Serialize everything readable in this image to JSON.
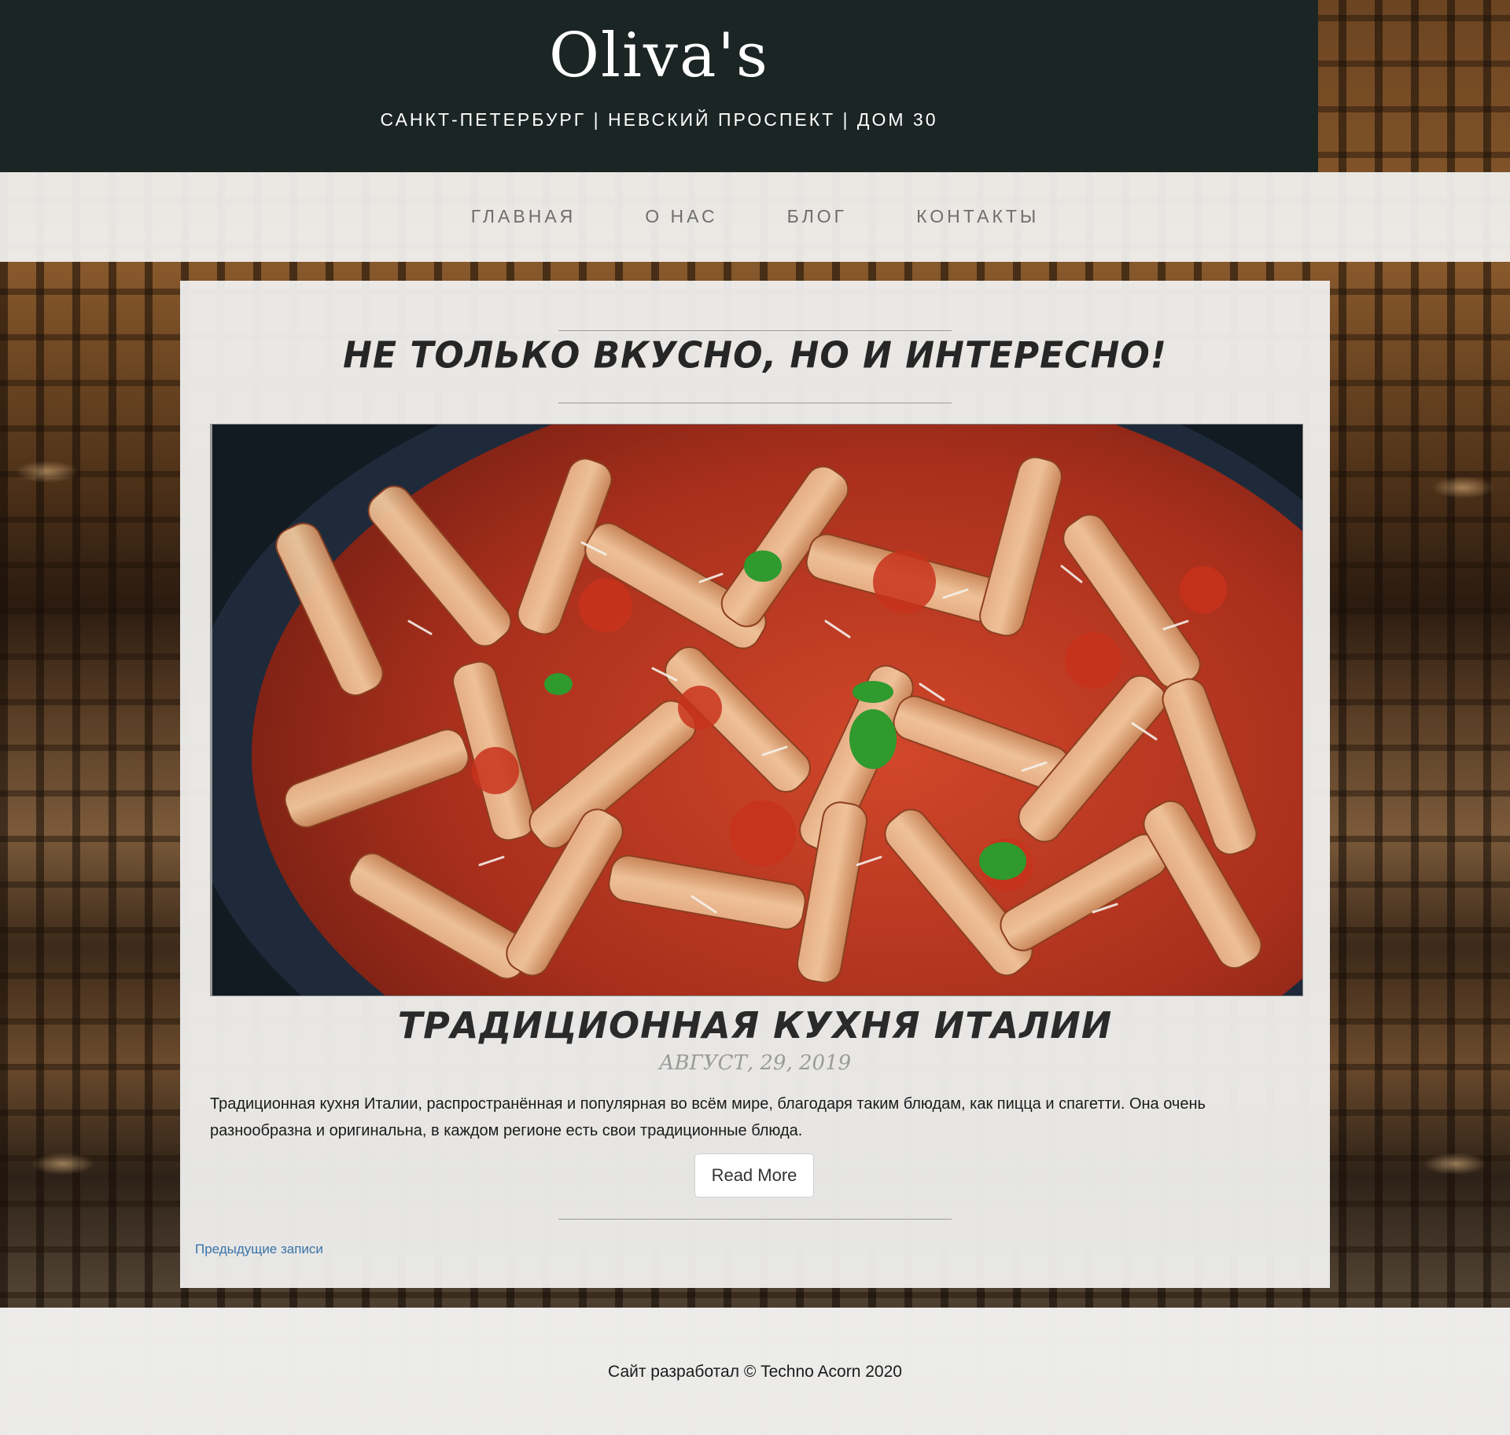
{
  "header": {
    "brand": "Oliva's",
    "address": "САНКТ-ПЕТЕРБУРГ | НЕВСКИЙ ПРОСПЕКТ | ДОМ 30"
  },
  "nav": {
    "items": [
      {
        "label": "ГЛАВНАЯ"
      },
      {
        "label": "О НАС"
      },
      {
        "label": "БЛОГ"
      },
      {
        "label": "КОНТАКТЫ"
      }
    ]
  },
  "main": {
    "headline": "НЕ ТОЛЬКО ВКУСНО, НО И ИНТЕРЕСНО!",
    "post": {
      "image_alt": "penne-pasta-dish-image",
      "title": "ТРАДИЦИОННАЯ КУХНЯ ИТАЛИИ",
      "date": "АВГУСТ, 29, 2019",
      "excerpt": "Традиционная кухня Италии, распространённая и популярная во всём мире, благодаря таким блюдам, как пицца и спагетти. Она очень разнообразна и оригинальна, в каждом регионе есть свои традиционные блюда.",
      "read_more_label": "Read More"
    },
    "pagination": {
      "previous_label": "Предыдущие записи"
    }
  },
  "footer": {
    "text": "Сайт разработал © Techno Acorn 2020"
  },
  "colors": {
    "header_bg": "#1b2524",
    "link": "#3a73a8",
    "nav_text": "#6e6e6e"
  }
}
